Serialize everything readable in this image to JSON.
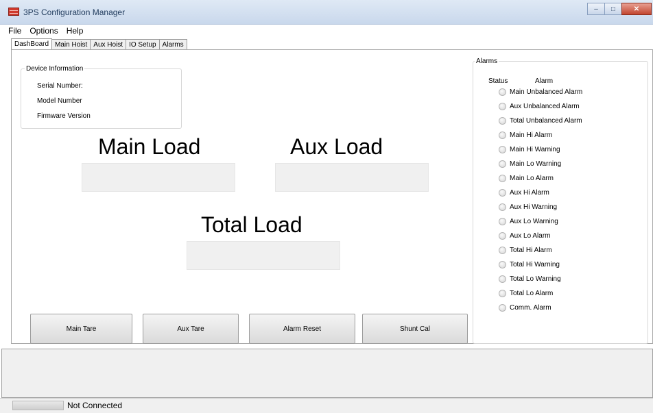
{
  "window": {
    "title": "3PS Configuration Manager",
    "minimize": "–",
    "maximize": "□",
    "close": "✕"
  },
  "menu": [
    "File",
    "Options",
    "Help"
  ],
  "tabs": [
    "DashBoard",
    "Main Hoist",
    "Aux Hoist",
    "IO Setup",
    "Alarms"
  ],
  "device_info": {
    "legend": "Device Information",
    "serial": "Serial Number:",
    "model": "Model Number",
    "firmware": "Firmware Version"
  },
  "loads": {
    "main": "Main Load",
    "aux": "Aux Load",
    "total": "Total Load"
  },
  "buttons": {
    "main_tare": "Main Tare",
    "aux_tare": "Aux Tare",
    "alarm_reset": "Alarm Reset",
    "shunt_cal": "Shunt Cal"
  },
  "alarms": {
    "legend": "Alarms",
    "status_header": "Status",
    "alarm_header": "Alarm",
    "items": [
      "Main Unbalanced Alarm",
      "Aux Unbalanced Alarm",
      "Total Unbalanced Alarm",
      "Main Hi Alarm",
      "Main Hi Warning",
      "Main Lo Warning",
      "Main Lo Alarm",
      "Aux Hi Alarm",
      "Aux Hi Warning",
      "Aux Lo Warning",
      "Aux Lo Alarm",
      "Total Hi Alarm",
      "Total Hi Warning",
      "Total Lo Warning",
      "Total Lo Alarm",
      "Comm. Alarm"
    ]
  },
  "status": {
    "connection": "Not Connected"
  }
}
